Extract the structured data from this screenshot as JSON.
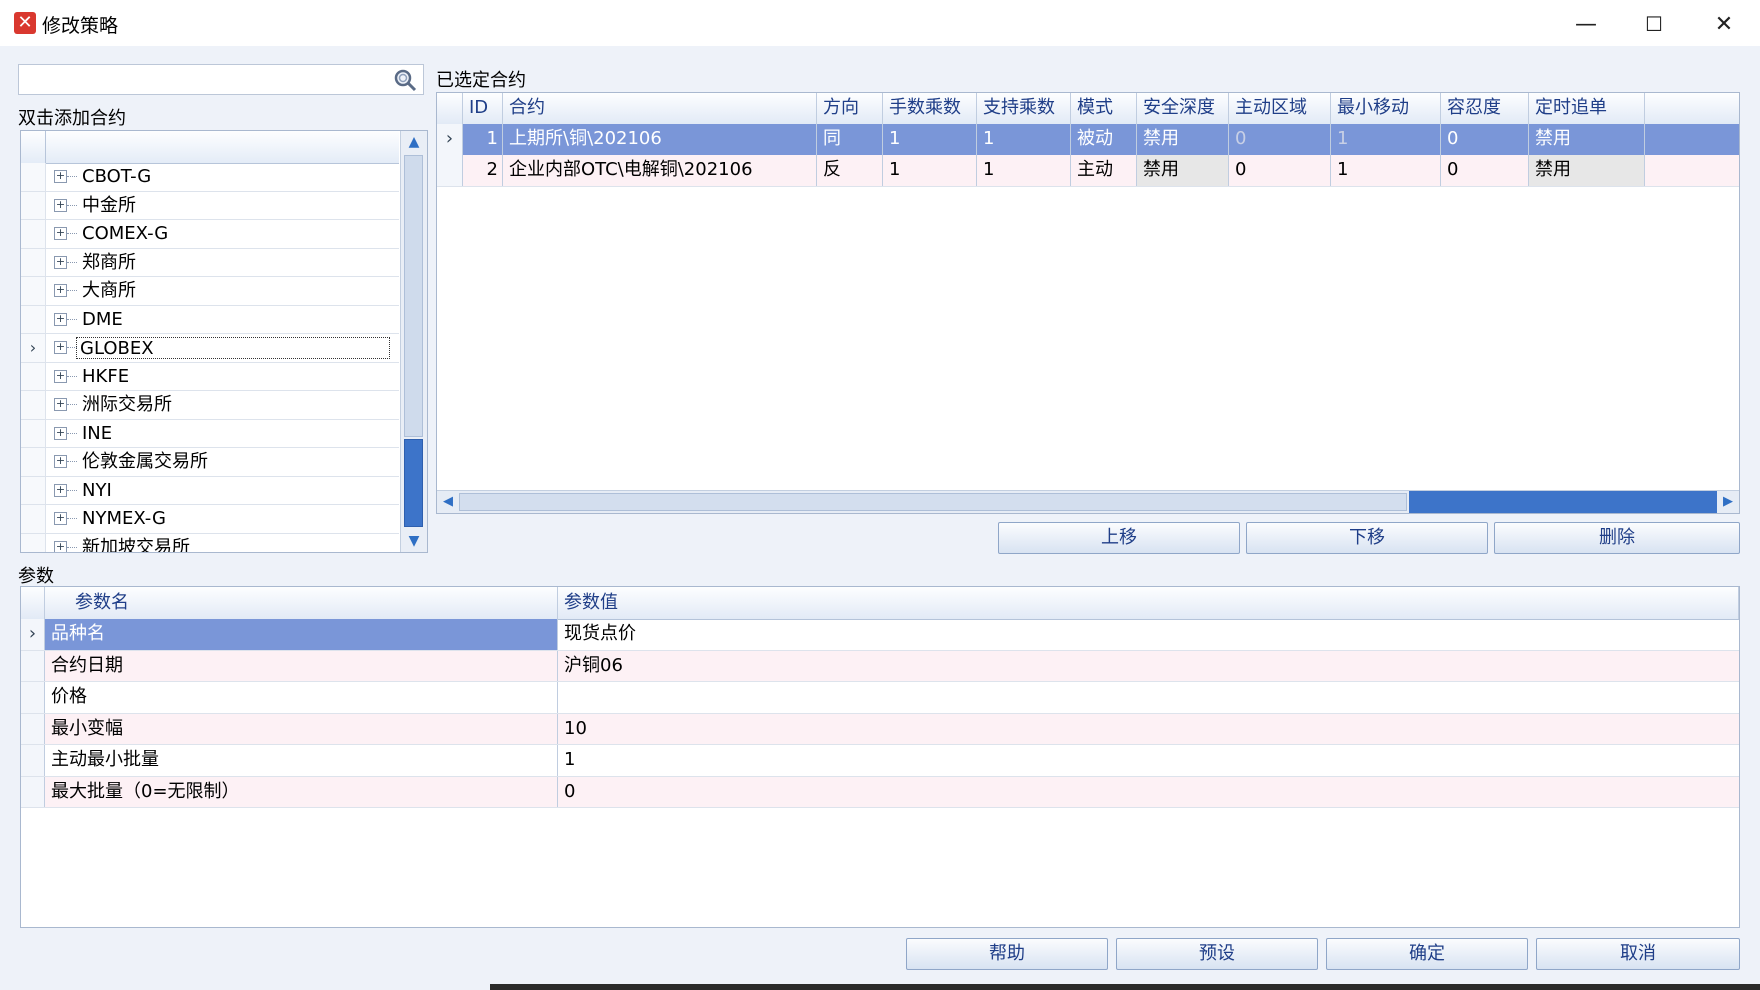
{
  "window": {
    "title": "修改策略",
    "minimize_glyph": "—",
    "maximize_glyph": "☐",
    "close_glyph": "✕"
  },
  "left": {
    "search_placeholder": "",
    "tree_label": "双击添加合约",
    "tree_items": [
      {
        "label": "CBOT-G",
        "selected": false
      },
      {
        "label": "中金所",
        "selected": false
      },
      {
        "label": "COMEX-G",
        "selected": false
      },
      {
        "label": "郑商所",
        "selected": false
      },
      {
        "label": "大商所",
        "selected": false
      },
      {
        "label": "DME",
        "selected": false
      },
      {
        "label": "GLOBEX",
        "selected": true
      },
      {
        "label": "HKFE",
        "selected": false
      },
      {
        "label": "洲际交易所",
        "selected": false
      },
      {
        "label": "INE",
        "selected": false
      },
      {
        "label": "伦敦金属交易所",
        "selected": false
      },
      {
        "label": "NYI",
        "selected": false
      },
      {
        "label": "NYMEX-G",
        "selected": false
      },
      {
        "label": "新加坡交易所",
        "selected": false
      }
    ]
  },
  "selected_contracts": {
    "label": "已选定合约",
    "columns": [
      "ID",
      "合约",
      "方向",
      "手数乘数",
      "支持乘数",
      "模式",
      "安全深度",
      "主动区域",
      "最小移动",
      "容忍度",
      "定时追单"
    ],
    "rows": [
      {
        "id": "1",
        "contract": "上期所\\铜\\202106",
        "direction": "同",
        "lots_mult": "1",
        "support_mult": "1",
        "mode": "被动",
        "safe_depth": "禁用",
        "active_zone": "0",
        "min_move": "1",
        "tolerance": "0",
        "timed_chase": "禁用"
      },
      {
        "id": "2",
        "contract": "企业内部OTC\\电解铜\\202106",
        "direction": "反",
        "lots_mult": "1",
        "support_mult": "1",
        "mode": "主动",
        "safe_depth": "禁用",
        "active_zone": "0",
        "min_move": "1",
        "tolerance": "0",
        "timed_chase": "禁用"
      }
    ],
    "buttons": {
      "up": "上移",
      "down": "下移",
      "delete": "删除"
    }
  },
  "params": {
    "label": "参数",
    "columns": [
      "参数名",
      "参数值"
    ],
    "rows": [
      {
        "name": "品种名",
        "value": "现货点价"
      },
      {
        "name": "合约日期",
        "value": "沪铜06"
      },
      {
        "name": "价格",
        "value": ""
      },
      {
        "name": "最小变幅",
        "value": "10"
      },
      {
        "name": "主动最小批量",
        "value": "1"
      },
      {
        "name": "最大批量（0=无限制）",
        "value": "0"
      }
    ]
  },
  "footer": {
    "help": "帮助",
    "preset": "预设",
    "ok": "确定",
    "cancel": "取消"
  }
}
